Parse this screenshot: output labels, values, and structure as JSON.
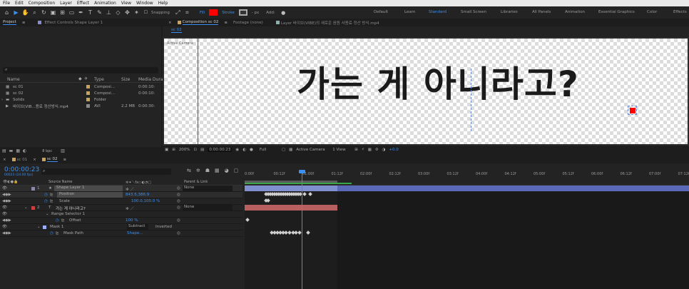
{
  "menu": [
    "File",
    "Edit",
    "Composition",
    "Layer",
    "Effect",
    "Animation",
    "View",
    "Window",
    "Help"
  ],
  "toolbar": {
    "snapping": "Snapping",
    "fill": "Fill",
    "stroke": "Stroke",
    "stroke_px": "- px",
    "add": "Add:",
    "fill_color": "#ff0000",
    "stroke_color": "#8a1a1a"
  },
  "workspaces": [
    {
      "label": "Default",
      "active": false
    },
    {
      "label": "Learn",
      "active": false
    },
    {
      "label": "Standard",
      "active": true
    },
    {
      "label": "Small Screen",
      "active": false
    },
    {
      "label": "Libraries",
      "active": false
    },
    {
      "label": "All Panels",
      "active": false
    },
    {
      "label": "Animation",
      "active": false
    },
    {
      "label": "Essential Graphics",
      "active": false
    },
    {
      "label": "Color",
      "active": false
    },
    {
      "label": "Effects",
      "active": false
    }
  ],
  "project": {
    "tab_project": "Project",
    "tab_effect_controls": "Effect Controls Shape Layer 1",
    "search_placeholder": "",
    "columns": {
      "name": "Name",
      "type": "Type",
      "size": "Size",
      "duration": "Media Duration"
    },
    "items": [
      {
        "name": "sc 01",
        "type": "Composi...",
        "size": "",
        "duration": "0:00:10:",
        "color": "#c9a35a"
      },
      {
        "name": "sc 02",
        "type": "Composi...",
        "size": "",
        "duration": "0:00:10:",
        "color": "#c9a35a"
      },
      {
        "name": "Solids",
        "type": "Folder",
        "size": "",
        "duration": "",
        "color": "#c9a35a"
      },
      {
        "name": "바이브(VIB...용료 정산방식.mp4",
        "type": "AVI",
        "size": "2.2 MB",
        "duration": "0:00:30:",
        "color": "#8a8a8a"
      }
    ],
    "bpc": "8 bpc"
  },
  "composition": {
    "tab_comp": "Composition sc 02",
    "tab_footage": "Footage (none)",
    "tab_layer": "Layer 바이브(VIBE)의 새로운 음원 사용료 정산 방식.mp4",
    "sub_tab": "sc 02",
    "active_camera_label": "Active Camera",
    "text": "가는 게 아니라고?",
    "zoom": "200%",
    "timecode": "0:00:00:23",
    "resolution": "Full",
    "camera": "Active Camera",
    "view": "1 View",
    "exposure": "+0.0"
  },
  "timeline": {
    "tab_sc01": "sc 01",
    "tab_sc02": "sc 02",
    "timecode": "0:00:00:23",
    "frame_info": "00023 (24.00 fps)",
    "search_placeholder": "",
    "col_source": "Source Name",
    "col_parent": "Parent & Link",
    "ruler": [
      "0:00f",
      "00:12f",
      "01:00f",
      "01:12f",
      "02:00f",
      "02:12f",
      "03:00f",
      "03:12f",
      "04:00f",
      "04:12f",
      "05:00f",
      "05:12f",
      "06:00f",
      "06:12f",
      "07:00f",
      "07:12f"
    ],
    "layers": [
      {
        "num": "1",
        "name": "Shape Layer 1",
        "parent": "None",
        "color": "#8a8aa8"
      },
      {
        "prop": "Position",
        "value": "843.5,386.9"
      },
      {
        "prop": "Scale",
        "value": "100.0,100.0 %"
      },
      {
        "num": "2",
        "name": "가는 게 아니라고?",
        "parent": "None",
        "color": "#c84040"
      },
      {
        "prop": "Range Selector 1"
      },
      {
        "prop": "Offset",
        "value": "100 %"
      },
      {
        "prop": "Mask 1",
        "mode": "Subtract",
        "inverted": "Inverted"
      },
      {
        "prop": "Mask Path",
        "value": "Shape..."
      }
    ]
  }
}
